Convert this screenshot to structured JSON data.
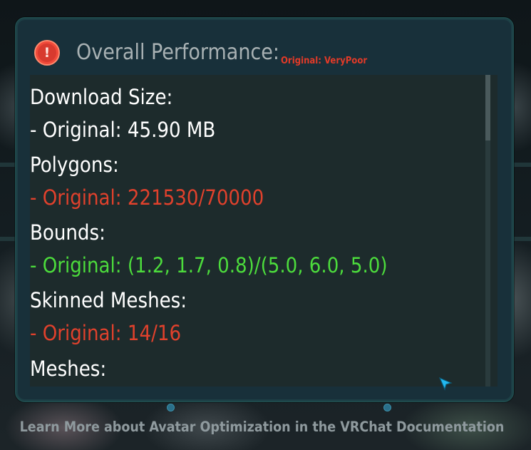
{
  "header": {
    "title": "Overall Performance:",
    "status": "Original: VeryPoor",
    "icon": "warning-icon"
  },
  "stats": [
    {
      "label": "Download Size:",
      "value": "- Original: 45.90 MB",
      "status": "ok"
    },
    {
      "label": "Polygons:",
      "value": "- Original: 221530/70000",
      "status": "over"
    },
    {
      "label": "Bounds:",
      "value": "- Original: (1.2, 1.7, 0.8)/(5.0, 6.0, 5.0)",
      "status": "good"
    },
    {
      "label": "Skinned Meshes:",
      "value": "- Original: 14/16",
      "status": "warn"
    },
    {
      "label": "Meshes:",
      "value": "",
      "status": ""
    }
  ],
  "footer": {
    "link": "Learn More about Avatar Optimization in the VRChat Documentation"
  },
  "colors": {
    "red": "#e0412c",
    "green": "#4cdc3c",
    "status_red": "#e23a28"
  }
}
